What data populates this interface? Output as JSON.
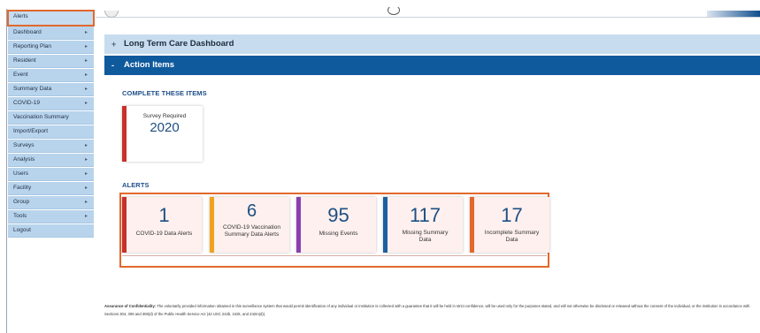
{
  "sidebar": {
    "items": [
      {
        "label": "Alerts",
        "chevron": false
      },
      {
        "label": "Dashboard",
        "chevron": true
      },
      {
        "label": "Reporting Plan",
        "chevron": true
      },
      {
        "label": "Resident",
        "chevron": true
      },
      {
        "label": "Event",
        "chevron": true
      },
      {
        "label": "Summary Data",
        "chevron": true
      },
      {
        "label": "COVID-19",
        "chevron": true
      },
      {
        "label": "Vaccination Summary",
        "chevron": false
      },
      {
        "label": "Import/Export",
        "chevron": false
      },
      {
        "label": "Surveys",
        "chevron": true
      },
      {
        "label": "Analysis",
        "chevron": true
      },
      {
        "label": "Users",
        "chevron": true
      },
      {
        "label": "Facility",
        "chevron": true
      },
      {
        "label": "Group",
        "chevron": true
      },
      {
        "label": "Tools",
        "chevron": true
      },
      {
        "label": "Logout",
        "chevron": false
      }
    ],
    "chevron_glyph": "▸"
  },
  "dashboard": {
    "ltc_title": "Long Term Care Dashboard",
    "ltc_toggle": "+",
    "actions_title": "Action Items",
    "actions_toggle": "-"
  },
  "complete": {
    "heading": "COMPLETE THESE ITEMS",
    "card_label": "Survey Required",
    "card_value": "2020"
  },
  "alerts": {
    "heading": "ALERTS",
    "cards": [
      {
        "value": "1",
        "label": "COVID-19 Data Alerts",
        "color": "#c9302c"
      },
      {
        "value": "6",
        "label": "COVID-19 Vaccination Summary Data Alerts",
        "color": "#f0a21e"
      },
      {
        "value": "95",
        "label": "Missing Events",
        "color": "#8b3fb0"
      },
      {
        "value": "117",
        "label": "Missing Summary Data",
        "color": "#1f5fa0"
      },
      {
        "value": "17",
        "label": "Incomplete Summary Data",
        "color": "#e2682c"
      }
    ]
  },
  "confidentiality": {
    "bold": "Assurance of Confidentiality:",
    "text": " The voluntarily provided information obtained in this surveillance system that would permit identification of any individual or institution is collected with a guarantee that it will be held in strict confidence, will be used only for the purposes stated, and will not otherwise be disclosed or released without the consent of the individual, or the institution in accordance with Sections 304, 306 and 308(d) of the Public Health Service Act (42 USC 242b, 242k, and 242m(d))."
  },
  "colors": {
    "accent_orange": "#e2682c",
    "header_blue": "#0f5a9c",
    "sidebar_blue": "#b8d4ec"
  }
}
